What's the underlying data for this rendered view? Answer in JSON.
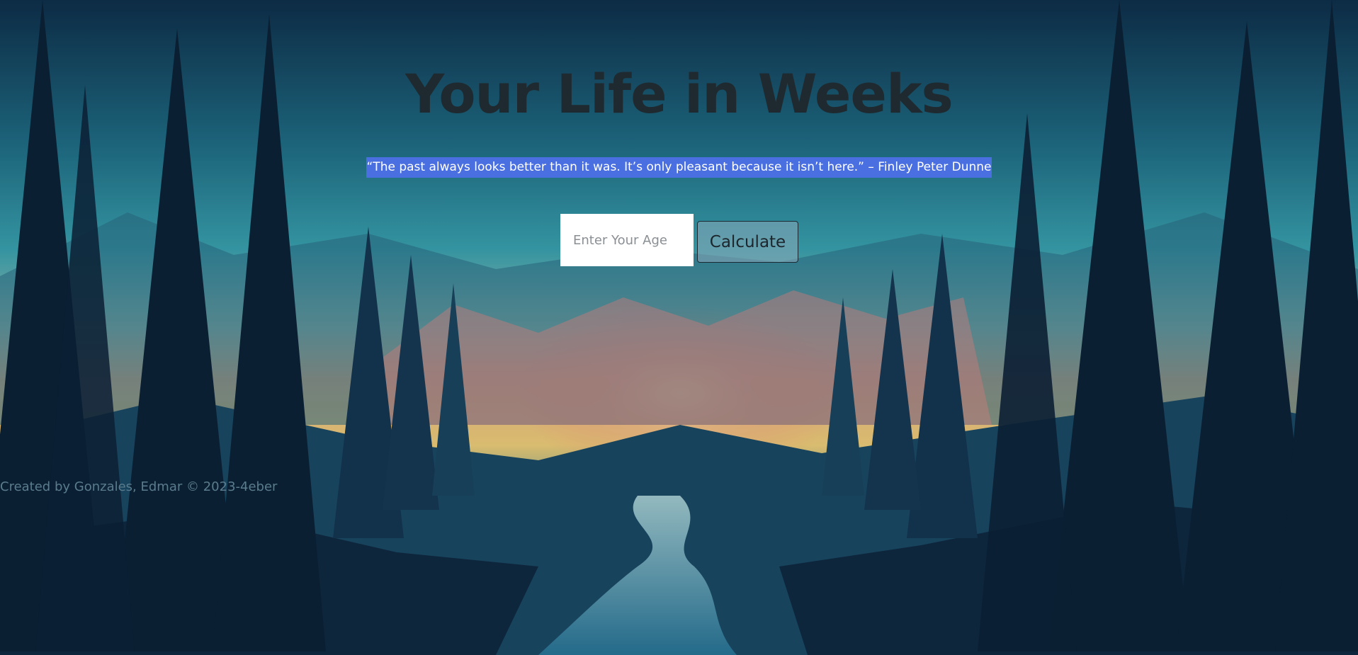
{
  "header": {
    "title": "Your Life in Weeks",
    "quote": "“The past always looks better than it was. It’s only pleasant because it isn’t here.” – Finley Peter Dunne"
  },
  "form": {
    "age_placeholder": "Enter Your Age",
    "age_value": "",
    "calculate_label": "Calculate"
  },
  "footer": {
    "credit": "Created by Gonzales, Edmar © 2023-4eber"
  },
  "colors": {
    "quote_highlight": "#4a6fe0",
    "title": "#1f2a30",
    "sky_top": "#0d2e48",
    "sky_mid": "#2a9aa5",
    "sunset": "#f6d27a",
    "forest_dark": "#0b1a30"
  },
  "background": {
    "icon": "forest-sunset-landscape"
  }
}
